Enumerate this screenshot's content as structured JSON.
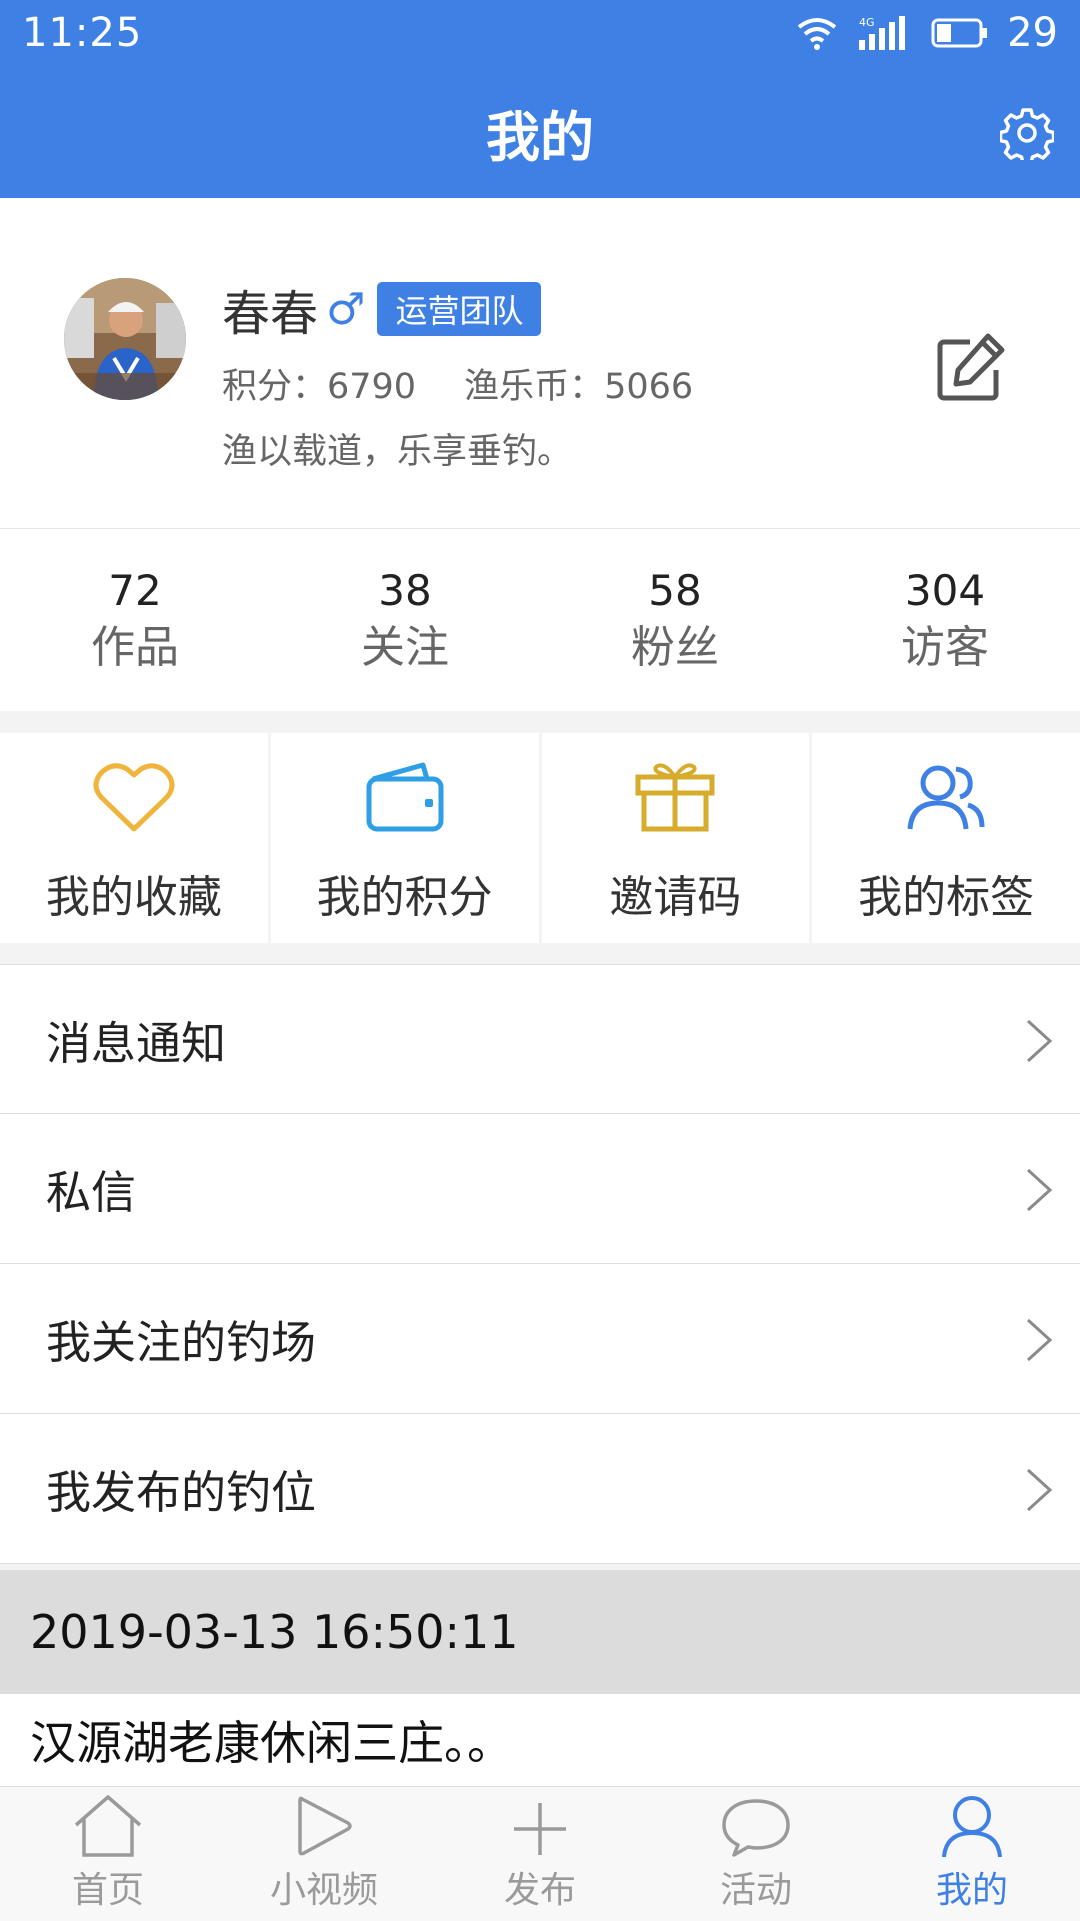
{
  "status_bar": {
    "time": "11:25",
    "battery": "29"
  },
  "header": {
    "title": "我的"
  },
  "profile": {
    "name": "春春",
    "gender_symbol": "♂",
    "badge": "运营团队",
    "points_text": "积分：6790",
    "coins_text": "渔乐币：5066",
    "motto": "渔以载道，乐享垂钓。"
  },
  "counts": [
    {
      "value": "72",
      "label": "作品"
    },
    {
      "value": "38",
      "label": "关注"
    },
    {
      "value": "58",
      "label": "粉丝"
    },
    {
      "value": "304",
      "label": "访客"
    }
  ],
  "quick_actions": [
    {
      "label": "我的收藏",
      "icon": "heart-icon",
      "color": "#f0b43c"
    },
    {
      "label": "我的积分",
      "icon": "wallet-icon",
      "color": "#2e9ee6"
    },
    {
      "label": "邀请码",
      "icon": "gift-icon",
      "color": "#d7ab2c"
    },
    {
      "label": "我的标签",
      "icon": "users-icon",
      "color": "#3e80e4"
    }
  ],
  "menu": [
    {
      "label": "消息通知"
    },
    {
      "label": "私信"
    },
    {
      "label": "我关注的钓场"
    },
    {
      "label": "我发布的钓位"
    }
  ],
  "feed": {
    "date": "2019-03-13 16:50:11",
    "title": "汉源湖老康休闲三庄。。"
  },
  "tabs": [
    {
      "label": "首页",
      "icon": "home-icon",
      "active": false
    },
    {
      "label": "小视频",
      "icon": "play-icon",
      "active": false
    },
    {
      "label": "发布",
      "icon": "plus-icon",
      "active": false
    },
    {
      "label": "活动",
      "icon": "chat-bubble-icon",
      "active": false
    },
    {
      "label": "我的",
      "icon": "person-icon",
      "active": true
    }
  ],
  "colors": {
    "primary": "#3e80e4",
    "inactive": "#9a9a9a"
  }
}
